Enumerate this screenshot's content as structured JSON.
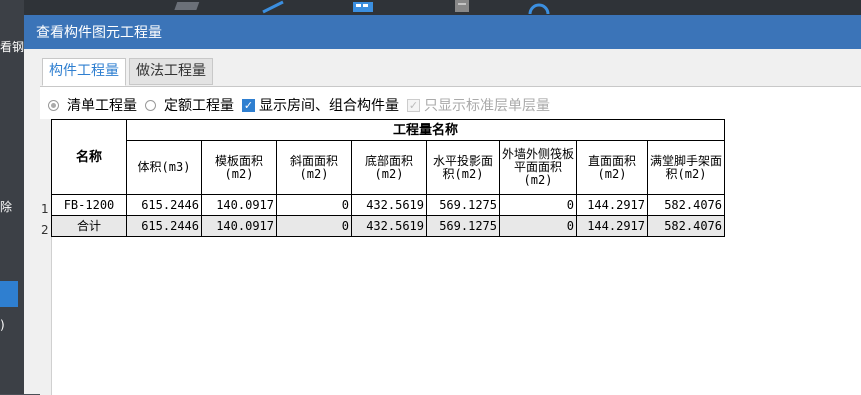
{
  "background": {
    "left_labels": [
      "看钢",
      "除",
      ")"
    ]
  },
  "dialog": {
    "title": "查看构件图元工程量",
    "tabs": [
      {
        "label": "构件工程量",
        "active": true
      },
      {
        "label": "做法工程量",
        "active": false
      }
    ],
    "options": {
      "qingdan": {
        "label": "清单工程量",
        "checked": true
      },
      "dinge": {
        "label": "定额工程量",
        "checked": false
      },
      "show_rooms": {
        "label": "显示房间、组合构件量",
        "checked": true
      },
      "only_std": {
        "label": "只显示标准层单层量",
        "checked": true,
        "disabled": true
      }
    },
    "table": {
      "group_header": "工程量名称",
      "name_header": "名称",
      "columns": [
        "体积(m3)",
        "模板面积(m2)",
        "斜面面积(m2)",
        "底部面积(m2)",
        "水平投影面积(m2)",
        "外墙外侧筏板平面面积(m2)",
        "直面面积(m2)",
        "满堂脚手架面积(m2)"
      ],
      "row_numbers": [
        "1",
        "2"
      ],
      "rows": [
        {
          "name": "FB-1200",
          "values": [
            "615.2446",
            "140.0917",
            "0",
            "432.5619",
            "569.1275",
            "0",
            "144.2917",
            "582.4076"
          ]
        },
        {
          "name": "合计",
          "values": [
            "615.2446",
            "140.0917",
            "0",
            "432.5619",
            "569.1275",
            "0",
            "144.2917",
            "582.4076"
          ]
        }
      ]
    }
  }
}
